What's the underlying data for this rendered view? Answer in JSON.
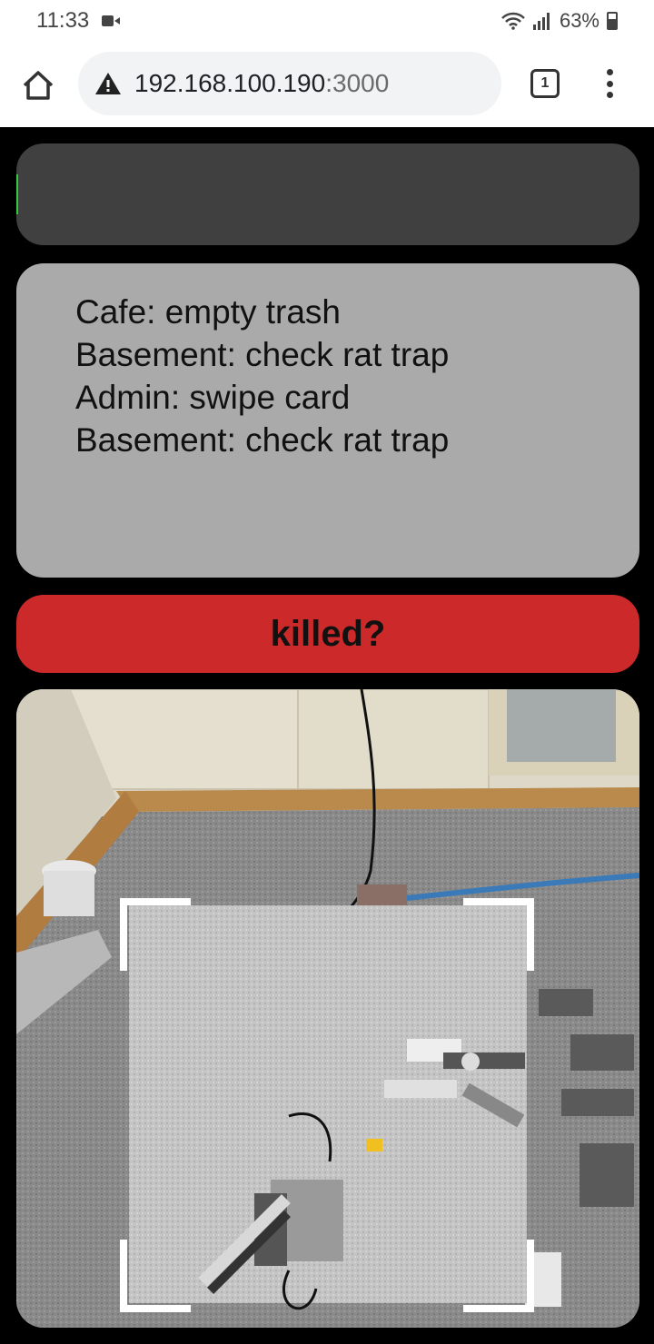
{
  "status_bar": {
    "time": "11:33",
    "battery": "63%"
  },
  "browser": {
    "url_host": "192.168.100.190",
    "url_port": ":3000",
    "tab_count": "1"
  },
  "tasks": [
    "Cafe: empty trash",
    "Basement: check rat trap",
    "Admin: swipe card",
    "Basement: check rat trap"
  ],
  "action_button": {
    "label": "killed?"
  },
  "icons": {
    "home": "home-icon",
    "warning": "warning-icon",
    "tabs": "tabs-icon",
    "menu": "more-vert-icon",
    "video": "video-camera-icon",
    "wifi": "wifi-icon",
    "signal": "signal-icon",
    "battery": "battery-icon"
  },
  "colors": {
    "action_button": "#cc2a2a",
    "task_panel": "#aaaaaa",
    "top_panel": "#404040"
  }
}
